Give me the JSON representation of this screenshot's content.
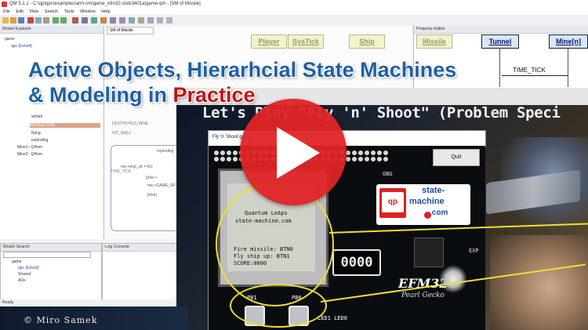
{
  "qm_window": {
    "title": "QM 5.1.1 - C:\\qp\\qpc\\examples\\arm-cm\\game_efm32-slstk3401a\\game-qm - [SM of Missile]",
    "menu": [
      "File",
      "Edit",
      "View",
      "Search",
      "Tools",
      "Window",
      "Help"
    ],
    "diagram_tab": "SM of Missile",
    "model_explorer": {
      "header": "Model Explorer",
      "items": [
        {
          "text": "game"
        },
        {
          "text": "qpc [locked]"
        },
        {
          "text": "armed"
        },
        {
          "text": "MISSILE FIRE"
        },
        {
          "text": "flying"
        },
        {
          "text": "exploding"
        },
        {
          "text": "Mine1 : QHsm"
        },
        {
          "text": "Mine2 : QHsm"
        }
      ]
    },
    "property_editor": {
      "header": "Property Editor"
    },
    "model_search": {
      "header": "Model Search",
      "items": [
        {
          "text": "game"
        },
        {
          "text": "qpc [locked]"
        },
        {
          "text": "Shared"
        },
        {
          "text": "AOs"
        }
      ]
    },
    "log_console": {
      "header": "Log Console"
    },
    "status": "Ready",
    "diagram": {
      "state_exploding": "exploding",
      "labels": [
        "DESTROYED_MINE",
        "HIT_WALL",
        "TIME_TICK",
        "me->exp_ctr = 0U;",
        "[else]",
        "[(me->",
        "me->GAME_SP"
      ]
    }
  },
  "sequence_lanes": [
    {
      "label": "Player",
      "faded": true
    },
    {
      "label": "SysTick",
      "faded": true
    },
    {
      "label": "Ship",
      "faded": true
    },
    {
      "label": "Missile",
      "faded": true
    },
    {
      "label": "Tunnel",
      "faded": false
    },
    {
      "label": "Mine[n]",
      "faded": false
    }
  ],
  "sequence_event": "TIME_TICK",
  "overlay_title": {
    "line1": "Active Objects, Hierarhcial State Machines",
    "line2_prefix": "& Modeling in ",
    "line2_accent": "Practice",
    "color": "#1f5fa4",
    "accent_color": "#c01414"
  },
  "slide_title": "Let's Play \"Fly 'n' Shoot\" (Problem Speci",
  "game_window": {
    "title": "Fly 'n' Shoot game",
    "quit_label": "Quit",
    "lcd_lines": [
      "Quantum LeAps",
      "state-machine.com",
      "Fire missile: BTN0",
      "Fly ship up: BTN1",
      "SCORE:0000"
    ],
    "segment_display": "0000"
  },
  "board": {
    "brand": "EFM32",
    "subbrand": "Pearl Gecko",
    "logo_qp": "qp",
    "logo_state": "state-",
    "logo_machine": "machine",
    "logo_com": ".com",
    "buttons": [
      {
        "label": "PB1"
      },
      {
        "label": "PB0"
      }
    ],
    "led_label": "LED1 LED0",
    "obg_label": "OBG",
    "exp_label": "EXP"
  },
  "play_button": {
    "icon": "play-icon",
    "color": "#e02426"
  },
  "copyright": "© Miro Samek"
}
